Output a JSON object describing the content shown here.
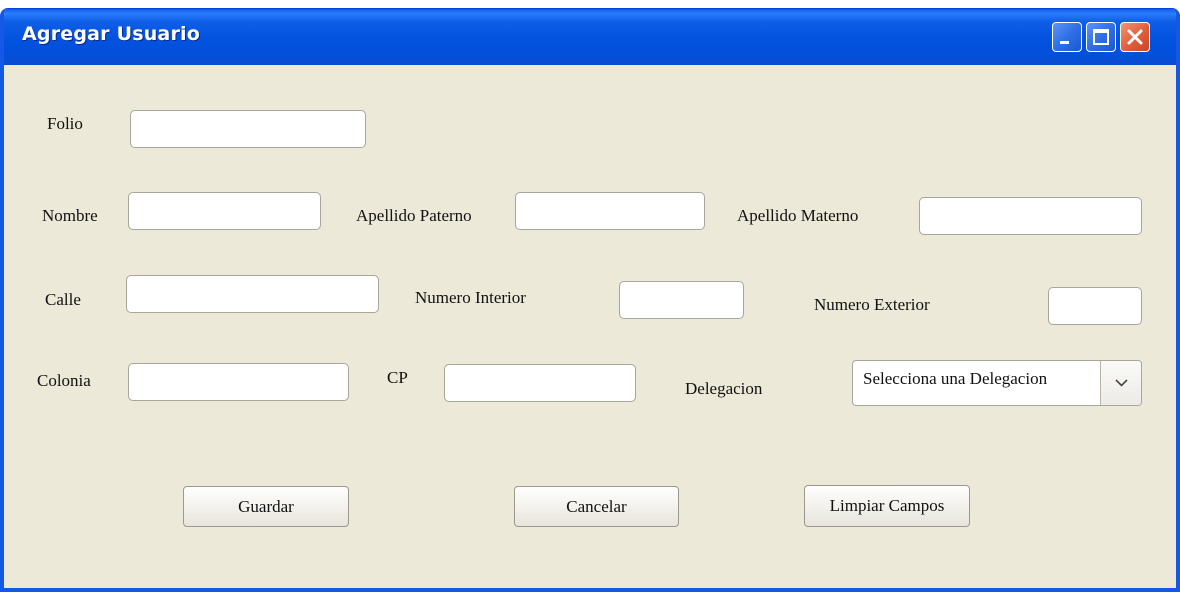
{
  "window": {
    "title": "Agregar Usuario",
    "title_color": "#ffffff",
    "titlebar_color": "#0352df",
    "body_color": "#ece9d8"
  },
  "window_controls": {
    "minimize_icon": "minimize-icon",
    "maximize_icon": "maximize-icon",
    "close_icon": "close-icon"
  },
  "form": {
    "folio": {
      "label": "Folio",
      "value": ""
    },
    "nombre": {
      "label": "Nombre",
      "value": ""
    },
    "apellido_paterno": {
      "label": "Apellido Paterno",
      "value": ""
    },
    "apellido_materno": {
      "label": "Apellido Materno",
      "value": ""
    },
    "calle": {
      "label": "Calle",
      "value": ""
    },
    "numero_interior": {
      "label": "Numero Interior",
      "value": ""
    },
    "numero_exterior": {
      "label": "Numero Exterior",
      "value": ""
    },
    "colonia": {
      "label": "Colonia",
      "value": ""
    },
    "cp": {
      "label": "CP",
      "value": ""
    },
    "delegacion": {
      "label": "Delegacion",
      "selected": "Selecciona una Delegacion",
      "arrow_icon": "chevron-down-icon"
    }
  },
  "buttons": {
    "guardar": "Guardar",
    "cancelar": "Cancelar",
    "limpiar": "Limpiar Campos"
  }
}
